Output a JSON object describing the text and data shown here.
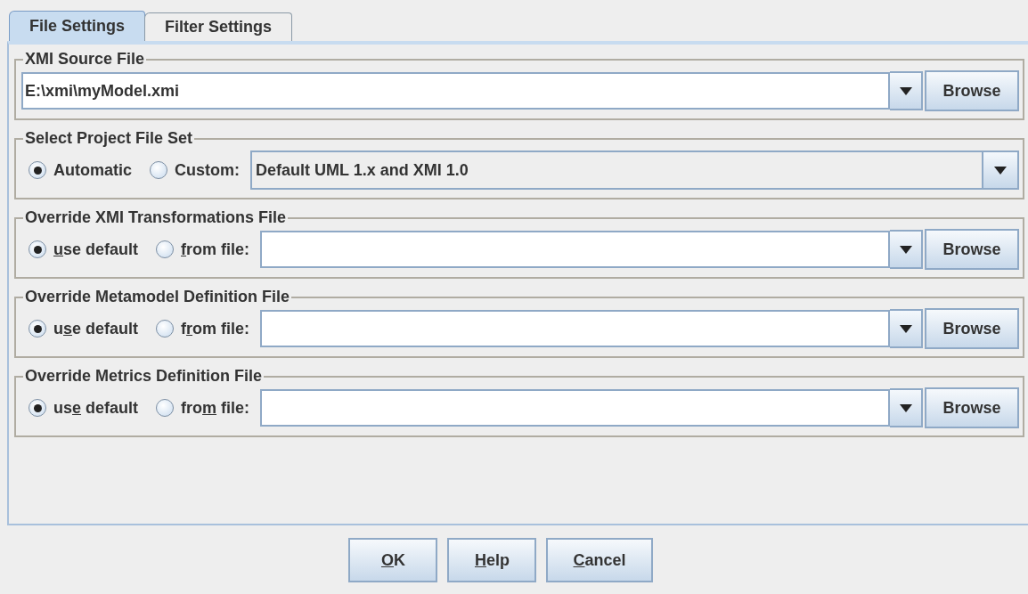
{
  "tabs": [
    {
      "label": "File Settings",
      "selected": true
    },
    {
      "label": "Filter Settings",
      "selected": false
    }
  ],
  "groups": [
    {
      "kind": "file",
      "title": "XMI Source File",
      "value": "E:\\xmi\\myModel.xmi",
      "button": "Browse"
    },
    {
      "kind": "choice",
      "title": "Select Project File Set",
      "options": [
        {
          "label": {
            "text": "Automatic"
          },
          "selected": true
        },
        {
          "label": {
            "text": "Custom:"
          },
          "selected": false
        }
      ],
      "combo": "Default UML 1.x and XMI 1.0"
    },
    {
      "kind": "override",
      "title": "Override XMI Transformations File",
      "options": [
        {
          "label": {
            "key": "u",
            "post": "se default"
          },
          "selected": true
        },
        {
          "label": {
            "key": "f",
            "post": "rom file:"
          },
          "selected": false
        }
      ],
      "button": "Browse"
    },
    {
      "kind": "override",
      "title": "Override Metamodel Definition File",
      "options": [
        {
          "label": {
            "pre": "u",
            "key": "s",
            "post": "e default"
          },
          "selected": true
        },
        {
          "label": {
            "pre": "f",
            "key": "r",
            "post": "om file:"
          },
          "selected": false
        }
      ],
      "button": "Browse"
    },
    {
      "kind": "override",
      "title": "Override Metrics Definition File",
      "options": [
        {
          "label": {
            "pre": "us",
            "key": "e",
            "post": " default"
          },
          "selected": true
        },
        {
          "label": {
            "pre": "fro",
            "key": "m",
            "post": " file:"
          },
          "selected": false
        }
      ],
      "button": "Browse"
    }
  ],
  "buttons": [
    {
      "key": "O",
      "post": "K"
    },
    {
      "key": "H",
      "post": "elp"
    },
    {
      "key": "C",
      "post": "ancel"
    }
  ]
}
